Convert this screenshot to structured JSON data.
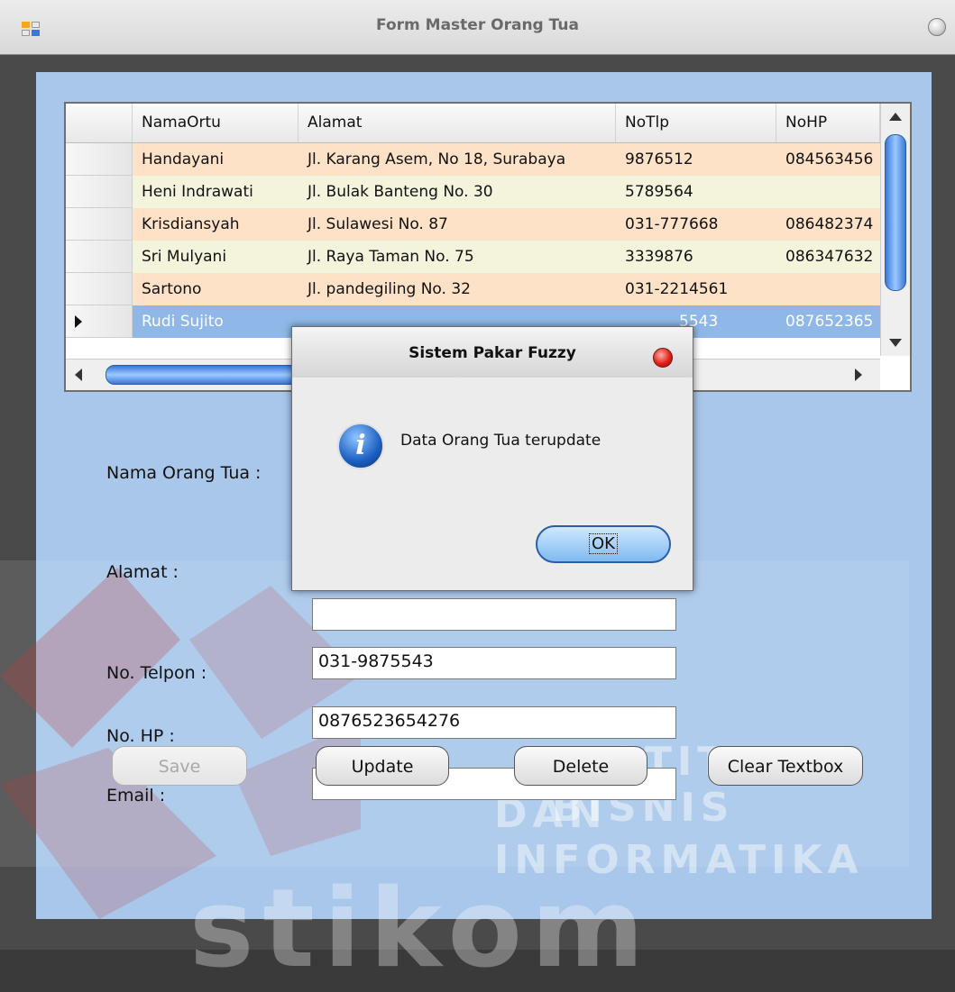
{
  "window": {
    "title": "Form Master Orang Tua"
  },
  "grid": {
    "columns": [
      "NamaOrtu",
      "Alamat",
      "NoTlp",
      "NoHP"
    ],
    "rows": [
      {
        "nama": "Handayani",
        "alamat": "Jl. Karang Asem, No 18, Surabaya",
        "tlp": "9876512",
        "hp": "084563456",
        "style": "peach"
      },
      {
        "nama": "Heni Indrawati",
        "alamat": "Jl. Bulak Banteng No. 30",
        "tlp": "5789564",
        "hp": "",
        "style": "cream"
      },
      {
        "nama": "Krisdiansyah",
        "alamat": "Jl. Sulawesi No. 87",
        "tlp": "031-777668",
        "hp": "086482374",
        "style": "peach"
      },
      {
        "nama": "Sri Mulyani",
        "alamat": "Jl. Raya Taman No. 75",
        "tlp": "3339876",
        "hp": "086347632",
        "style": "cream"
      },
      {
        "nama": "Sartono",
        "alamat": "Jl. pandegiling No. 32",
        "tlp": "031-2214561",
        "hp": "",
        "style": "peach"
      },
      {
        "nama": "Rudi Sujito",
        "alamat": "",
        "tlp": "5543",
        "hp": "087652365",
        "style": "selected"
      }
    ]
  },
  "form": {
    "nama_label": "Nama Orang Tua :",
    "alamat_label": "Alamat :",
    "telpon_label": "No. Telpon :",
    "hp_label": "No. HP :",
    "email_label": "Email :",
    "alamat_value": "",
    "telpon_value": "031-9875543",
    "hp_value": "0876523654276",
    "email_value": ""
  },
  "buttons": {
    "save": "Save",
    "update": "Update",
    "delete": "Delete",
    "clear": "Clear Textbox"
  },
  "dialog": {
    "title": "Sistem Pakar Fuzzy",
    "message": "Data Orang Tua terupdate",
    "ok": "OK",
    "icon": "info-icon"
  },
  "watermark": {
    "line1": "INSTITUT BISNIS",
    "line2": "DAN INFORMATIKA",
    "logo": "stikom"
  },
  "colors": {
    "client_bg": "#a8c7ea",
    "row_peach": "#fde2c8",
    "row_cream": "#f4f3dc",
    "row_selected": "#8fb8e8"
  }
}
